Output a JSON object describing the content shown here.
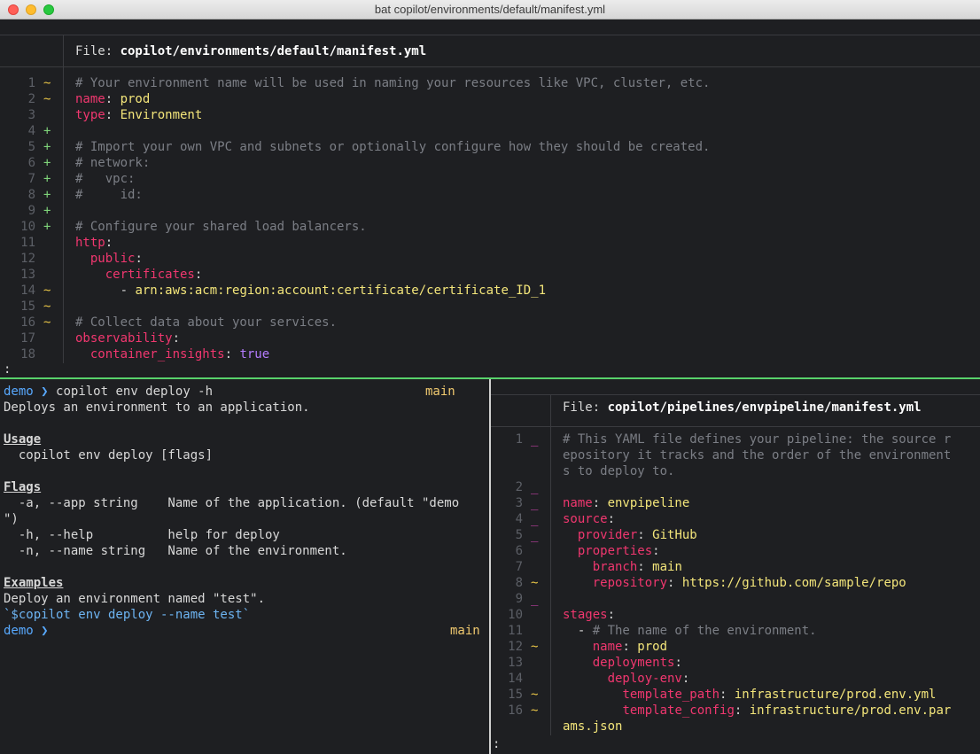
{
  "window": {
    "title": "bat copilot/environments/default/manifest.yml"
  },
  "top_pane": {
    "file_label": "File: ",
    "file_name": "copilot/environments/default/manifest.yml",
    "status_prompt": ":",
    "lines": [
      {
        "n": "1",
        "g": "~",
        "parts": [
          [
            "cm",
            "# Your environment name will be used in naming your resources like VPC, cluster, etc."
          ]
        ]
      },
      {
        "n": "2",
        "g": "~",
        "parts": [
          [
            "ky",
            "name"
          ],
          [
            "hd",
            ": "
          ],
          [
            "st",
            "prod"
          ]
        ]
      },
      {
        "n": "3",
        "g": "",
        "parts": [
          [
            "ky",
            "type"
          ],
          [
            "hd",
            ": "
          ],
          [
            "st",
            "Environment"
          ]
        ]
      },
      {
        "n": "4",
        "g": "+",
        "parts": []
      },
      {
        "n": "5",
        "g": "+",
        "parts": [
          [
            "cm",
            "# Import your own VPC and subnets or optionally configure how they should be created."
          ]
        ]
      },
      {
        "n": "6",
        "g": "+",
        "parts": [
          [
            "cm",
            "# network:"
          ]
        ]
      },
      {
        "n": "7",
        "g": "+",
        "parts": [
          [
            "cm",
            "#   vpc:"
          ]
        ]
      },
      {
        "n": "8",
        "g": "+",
        "parts": [
          [
            "cm",
            "#     id:"
          ]
        ]
      },
      {
        "n": "9",
        "g": "+",
        "parts": []
      },
      {
        "n": "10",
        "g": "+",
        "parts": [
          [
            "cm",
            "# Configure your shared load balancers."
          ]
        ]
      },
      {
        "n": "11",
        "g": "",
        "parts": [
          [
            "ky",
            "http"
          ],
          [
            "hd",
            ":"
          ]
        ]
      },
      {
        "n": "12",
        "g": "",
        "parts": [
          [
            "hd",
            "  "
          ],
          [
            "ky",
            "public"
          ],
          [
            "hd",
            ":"
          ]
        ]
      },
      {
        "n": "13",
        "g": "",
        "parts": [
          [
            "hd",
            "    "
          ],
          [
            "ky",
            "certificates"
          ],
          [
            "hd",
            ":"
          ]
        ]
      },
      {
        "n": "14",
        "g": "~",
        "parts": [
          [
            "hd",
            "      - "
          ],
          [
            "st",
            "arn:aws:acm:region:account:certificate/certificate_ID_1"
          ]
        ]
      },
      {
        "n": "15",
        "g": "~",
        "parts": []
      },
      {
        "n": "16",
        "g": "~",
        "parts": [
          [
            "cm",
            "# Collect data about your services."
          ]
        ]
      },
      {
        "n": "17",
        "g": "",
        "parts": [
          [
            "ky",
            "observability"
          ],
          [
            "hd",
            ":"
          ]
        ]
      },
      {
        "n": "18",
        "g": "",
        "parts": [
          [
            "hd",
            "  "
          ],
          [
            "ky",
            "container_insights"
          ],
          [
            "hd",
            ": "
          ],
          [
            "bl",
            "true"
          ]
        ]
      }
    ]
  },
  "left_pane": {
    "prompt_dir": "demo",
    "prompt_arrow": "❯",
    "command": "copilot env deploy -h",
    "branch": "main",
    "description": "Deploys an environment to an application.",
    "usage_heading": "Usage",
    "usage_line": "  copilot env deploy [flags]",
    "flags_heading": "Flags",
    "flags": [
      "  -a, --app string    Name of the application. (default \"demo",
      "\")",
      "  -h, --help          help for deploy",
      "  -n, --name string   Name of the environment."
    ],
    "examples_heading": "Examples",
    "example_desc": "Deploy an environment named \"test\".",
    "example_cmd": "`$copilot env deploy --name test`",
    "prompt2_dir": "demo",
    "prompt2_arrow": "❯",
    "branch2": "main"
  },
  "right_pane": {
    "file_label": "File: ",
    "file_name": "copilot/pipelines/envpipeline/manifest.yml",
    "status_prompt": ":",
    "lines": [
      {
        "n": "1",
        "g": "_",
        "parts": [
          [
            "cm",
            "# This YAML file defines your pipeline: the source r"
          ]
        ]
      },
      {
        "n": "",
        "g": "",
        "parts": [
          [
            "cm",
            "epository it tracks and the order of the environment"
          ]
        ]
      },
      {
        "n": "",
        "g": "",
        "parts": [
          [
            "cm",
            "s to deploy to."
          ]
        ]
      },
      {
        "n": "2",
        "g": "_",
        "parts": []
      },
      {
        "n": "3",
        "g": "_",
        "parts": [
          [
            "ky",
            "name"
          ],
          [
            "hd",
            ": "
          ],
          [
            "st",
            "envpipeline"
          ]
        ]
      },
      {
        "n": "4",
        "g": "_",
        "parts": [
          [
            "ky",
            "source"
          ],
          [
            "hd",
            ":"
          ]
        ]
      },
      {
        "n": "5",
        "g": "_",
        "parts": [
          [
            "hd",
            "  "
          ],
          [
            "ky",
            "provider"
          ],
          [
            "hd",
            ": "
          ],
          [
            "st",
            "GitHub"
          ]
        ]
      },
      {
        "n": "6",
        "g": "",
        "parts": [
          [
            "hd",
            "  "
          ],
          [
            "ky",
            "properties"
          ],
          [
            "hd",
            ":"
          ]
        ]
      },
      {
        "n": "7",
        "g": "",
        "parts": [
          [
            "hd",
            "    "
          ],
          [
            "ky",
            "branch"
          ],
          [
            "hd",
            ": "
          ],
          [
            "st",
            "main"
          ]
        ]
      },
      {
        "n": "8",
        "g": "~",
        "parts": [
          [
            "hd",
            "    "
          ],
          [
            "ky",
            "repository"
          ],
          [
            "hd",
            ": "
          ],
          [
            "st",
            "https://github.com/sample/repo"
          ]
        ]
      },
      {
        "n": "9",
        "g": "_",
        "parts": []
      },
      {
        "n": "10",
        "g": "",
        "parts": [
          [
            "ky",
            "stages"
          ],
          [
            "hd",
            ":"
          ]
        ]
      },
      {
        "n": "11",
        "g": "",
        "parts": [
          [
            "hd",
            "  - "
          ],
          [
            "cm",
            "# The name of the environment."
          ]
        ]
      },
      {
        "n": "12",
        "g": "~",
        "parts": [
          [
            "hd",
            "    "
          ],
          [
            "ky",
            "name"
          ],
          [
            "hd",
            ": "
          ],
          [
            "st",
            "prod"
          ]
        ]
      },
      {
        "n": "13",
        "g": "",
        "parts": [
          [
            "hd",
            "    "
          ],
          [
            "ky",
            "deployments"
          ],
          [
            "hd",
            ":"
          ]
        ]
      },
      {
        "n": "14",
        "g": "",
        "parts": [
          [
            "hd",
            "      "
          ],
          [
            "ky",
            "deploy-env"
          ],
          [
            "hd",
            ":"
          ]
        ]
      },
      {
        "n": "15",
        "g": "~",
        "parts": [
          [
            "hd",
            "        "
          ],
          [
            "ky",
            "template_path"
          ],
          [
            "hd",
            ": "
          ],
          [
            "st",
            "infrastructure/prod.env.yml"
          ]
        ]
      },
      {
        "n": "16",
        "g": "~",
        "parts": [
          [
            "hd",
            "        "
          ],
          [
            "ky",
            "template_config"
          ],
          [
            "hd",
            ": "
          ],
          [
            "st",
            "infrastructure/prod.env.par"
          ]
        ]
      },
      {
        "n": "",
        "g": "",
        "parts": [
          [
            "st",
            "ams.json"
          ]
        ]
      }
    ]
  },
  "colors": {
    "background": "#1e1f22",
    "comment": "#7b7e85",
    "key": "#f0376f",
    "string": "#f3e57a",
    "bool": "#b57cff",
    "git_modified": "#e8c547",
    "git_added": "#7fd47a",
    "git_removed": "#d146b2",
    "prompt": "#58a9ff",
    "branch": "#f0c96f",
    "active_divider": "#58d26b"
  }
}
